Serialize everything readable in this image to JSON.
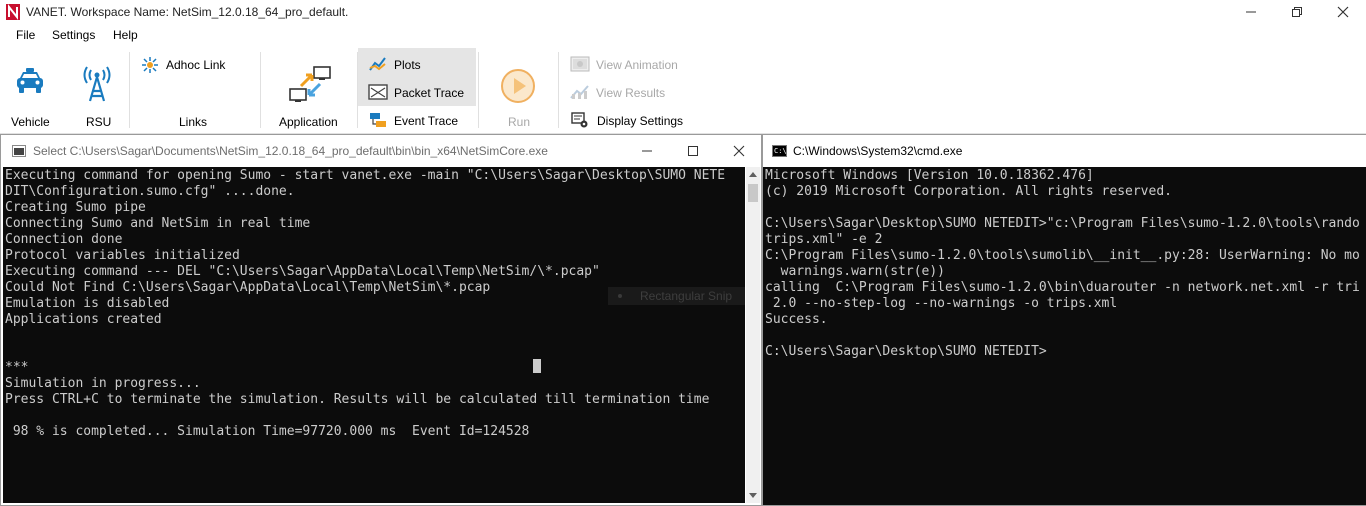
{
  "app": {
    "title": "VANET. Workspace Name: NetSim_12.0.18_64_pro_default."
  },
  "menu": [
    "File",
    "Settings",
    "Help"
  ],
  "ribbon": {
    "vehicle": "Vehicle",
    "rsu": "RSU",
    "adhoc_link": "Adhoc Link",
    "links": "Links",
    "application": "Application",
    "plots": "Plots",
    "packet_trace": "Packet Trace",
    "event_trace": "Event Trace",
    "run": "Run",
    "view_animation": "View Animation",
    "view_results": "View Results",
    "display_settings": "Display Settings"
  },
  "left_console": {
    "title": "Select C:\\Users\\Sagar\\Documents\\NetSim_12.0.18_64_pro_default\\bin\\bin_x64\\NetSimCore.exe",
    "text": "Executing command for opening Sumo - start vanet.exe -main \"C:\\Users\\Sagar\\Desktop\\SUMO NETE\nDIT\\Configuration.sumo.cfg\" ....done.\nCreating Sumo pipe\nConnecting Sumo and NetSim in real time\nConnection done\nProtocol variables initialized\nExecuting command --- DEL \"C:\\Users\\Sagar\\AppData\\Local\\Temp\\NetSim/\\*.pcap\"\nCould Not Find C:\\Users\\Sagar\\AppData\\Local\\Temp\\NetSim\\*.pcap\nEmulation is disabled\nApplications created\n\n\n***\nSimulation in progress...\nPress CTRL+C to terminate the simulation. Results will be calculated till termination time\n\n 98 % is completed... Simulation Time=97720.000 ms  Event Id=124528",
    "snip_tooltip": "Rectangular Snip"
  },
  "right_console": {
    "title": "C:\\Windows\\System32\\cmd.exe",
    "icon_text": "C:\\",
    "text": "Microsoft Windows [Version 10.0.18362.476]\n(c) 2019 Microsoft Corporation. All rights reserved.\n\nC:\\Users\\Sagar\\Desktop\\SUMO NETEDIT>\"c:\\Program Files\\sumo-1.2.0\\tools\\rando\ntrips.xml\" -e 2\nC:\\Program Files\\sumo-1.2.0\\tools\\sumolib\\__init__.py:28: UserWarning: No mo\n  warnings.warn(str(e))\ncalling  C:\\Program Files\\sumo-1.2.0\\bin\\duarouter -n network.net.xml -r tri\n 2.0 --no-step-log --no-warnings -o trips.xml\nSuccess.\n\nC:\\Users\\Sagar\\Desktop\\SUMO NETEDIT>"
  },
  "colors": {
    "console_bg": "#0c0c0c",
    "console_fg": "#cccccc",
    "accent_blue": "#1a7bbf",
    "ribbon_active": "#e5e5e5"
  }
}
